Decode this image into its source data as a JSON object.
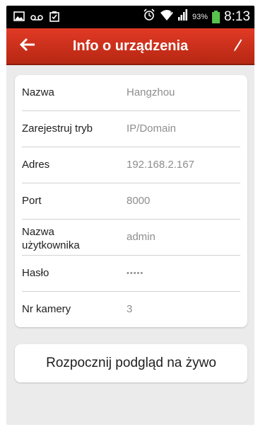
{
  "status_bar": {
    "battery_percent": "93%",
    "time": "8:13",
    "icons": [
      "image-icon",
      "voicemail-icon",
      "clipboard-icon",
      "alarm-icon",
      "wifi-icon",
      "signal-icon",
      "battery-icon"
    ],
    "battery_color": "#58c34c"
  },
  "action_bar": {
    "title": "Info o urządzenia",
    "back_icon": "arrow-left-icon",
    "edit_icon": "pencil-icon",
    "color": "#d0311c"
  },
  "device_info": {
    "rows": [
      {
        "label": "Nazwa",
        "value": "Hangzhou"
      },
      {
        "label": "Zarejestruj tryb",
        "value": "IP/Domain"
      },
      {
        "label": "Adres",
        "value": "192.168.2.167"
      },
      {
        "label": "Port",
        "value": "8000"
      },
      {
        "label": "Nazwa\nużytkownika",
        "value": "admin"
      },
      {
        "label": "Hasło",
        "value": "•••••"
      },
      {
        "label": "Nr kamery",
        "value": "3"
      }
    ]
  },
  "start_live_view_label": "Rozpocznij podgląd na żywo"
}
